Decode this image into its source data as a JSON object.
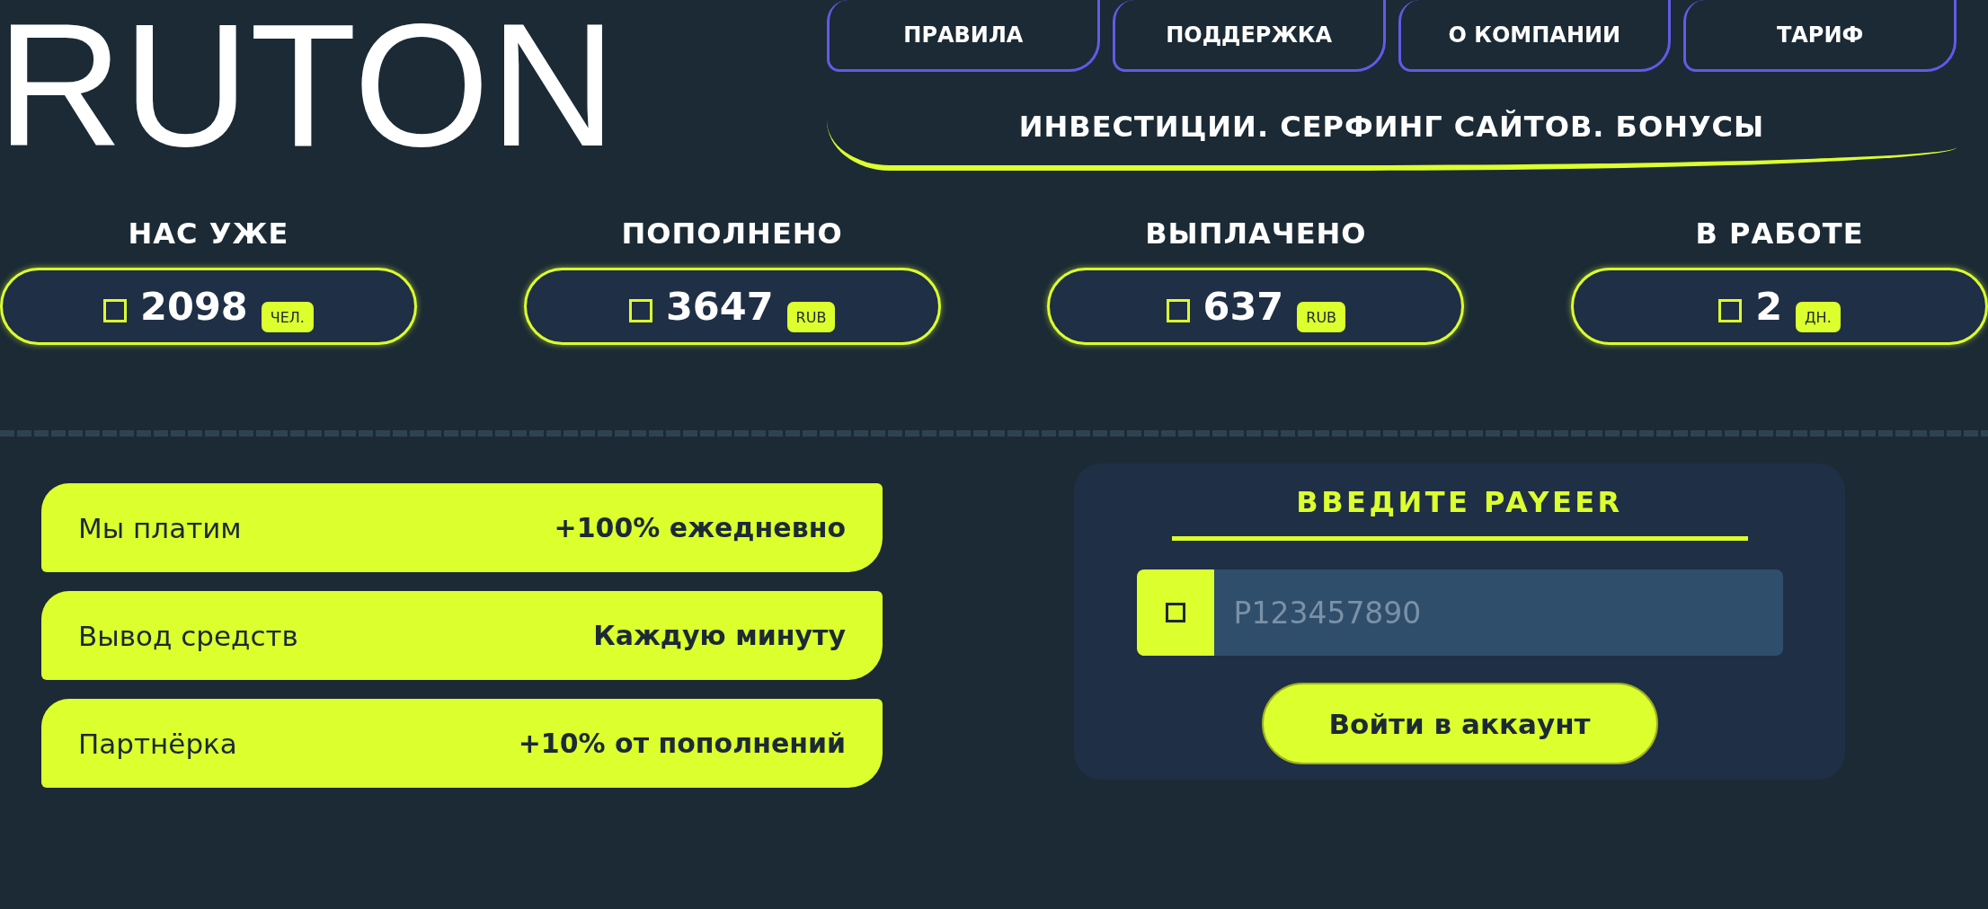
{
  "logo": {
    "text": "RUTON"
  },
  "nav": {
    "links": [
      {
        "label": "ПРАВИЛА"
      },
      {
        "label": "ПОДДЕРЖКА"
      },
      {
        "label": "О КОМПАНИИ"
      },
      {
        "label": "ТАРИФ"
      }
    ],
    "tagline": "ИНВЕСТИЦИИ. СЕРФИНГ САЙТОВ. БОНУСЫ"
  },
  "stats": [
    {
      "label": "НАС УЖЕ",
      "value": "2098",
      "unit": "ЧЕЛ."
    },
    {
      "label": "ПОПОЛНЕНО",
      "value": "3647",
      "unit": "RUB"
    },
    {
      "label": "ВЫПЛАЧЕНО",
      "value": "637",
      "unit": "RUB"
    },
    {
      "label": "В РАБОТЕ",
      "value": "2",
      "unit": "ДН."
    }
  ],
  "features": [
    {
      "name": "Мы платим",
      "value": "+100% ежедневно"
    },
    {
      "name": "Вывод средств",
      "value": "Каждую минуту"
    },
    {
      "name": "Партнёрка",
      "value": "+10% от пополнений"
    }
  ],
  "login": {
    "title": "ВВЕДИТЕ PAYEER",
    "field": {
      "placeholder": "P123457890"
    },
    "button": "Войти в аккаунт"
  }
}
